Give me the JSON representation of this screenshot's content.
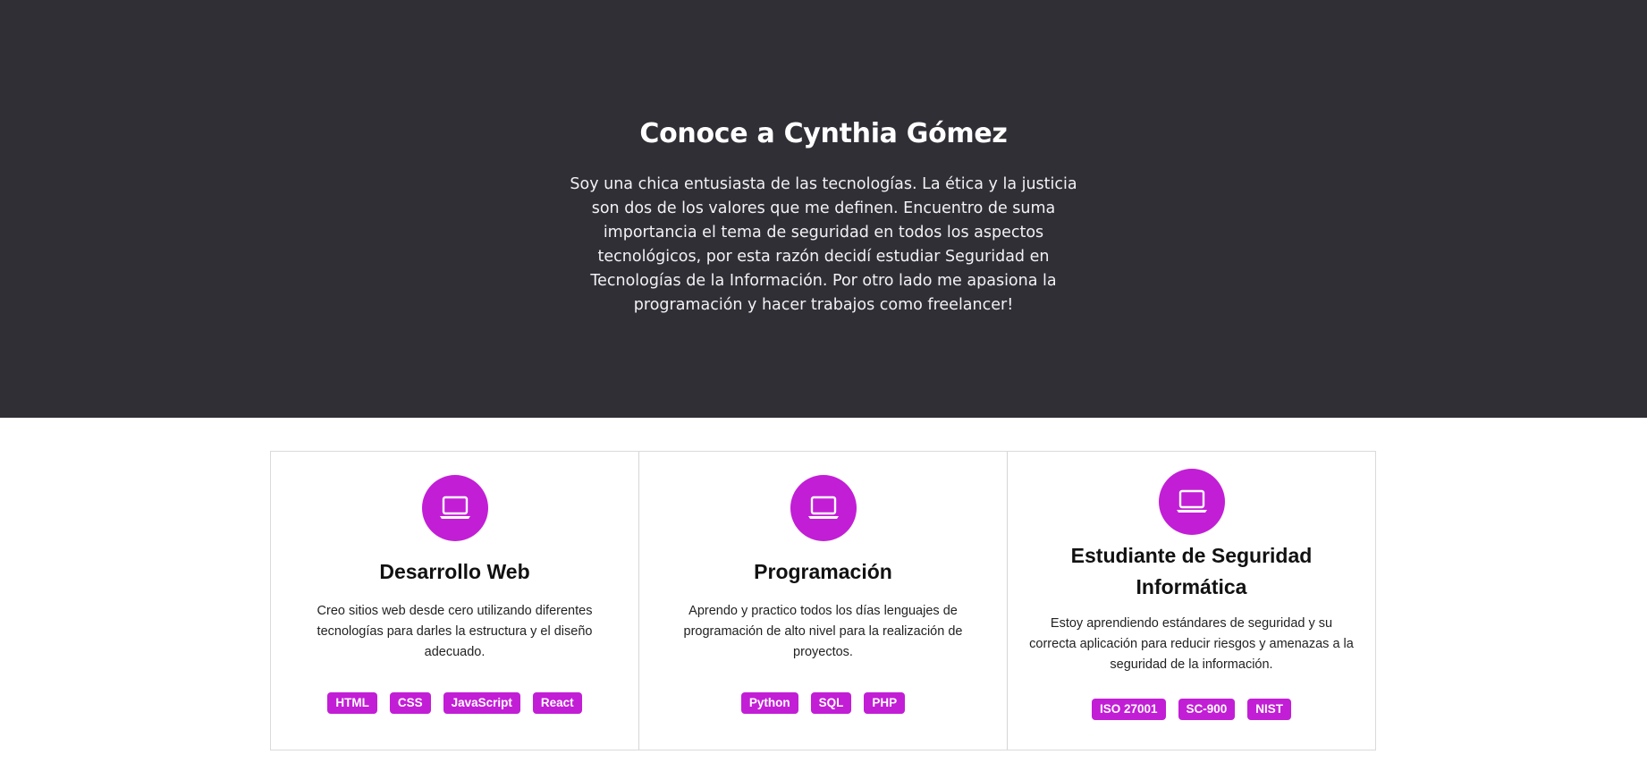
{
  "hero": {
    "title": "Conoce a Cynthia Gómez",
    "text": "Soy una chica entusiasta de las tecnologías. La ética y la justicia son dos de los valores que me definen. Encuentro de suma importancia el tema de seguridad en todos los aspectos tecnológicos, por esta razón decidí estudiar Seguridad en Tecnologías de la Información. Por otro lado me apasiona la programación y hacer trabajos como freelancer!"
  },
  "colors": {
    "hero_bg": "#302f36",
    "accent": "#c21ed6"
  },
  "cards": [
    {
      "icon": "laptop-icon",
      "title": "Desarrollo Web",
      "text": "Creo sitios web desde cero utilizando diferentes tecnologías para darles la estructura y el diseño adecuado.",
      "tags": [
        "HTML",
        "CSS",
        "JavaScript",
        "React"
      ]
    },
    {
      "icon": "laptop-icon",
      "title": "Programación",
      "text": "Aprendo y practico todos los días lenguajes de programación de alto nivel para la realización de proyectos.",
      "tags": [
        "Python",
        "SQL",
        "PHP"
      ]
    },
    {
      "icon": "laptop-icon",
      "title": "Estudiante de Seguridad Informática",
      "text": "Estoy aprendiendo estándares de seguridad y su correcta aplicación para reducir riesgos y amenazas a la seguridad de la información.",
      "tags": [
        "ISO 27001",
        "SC-900",
        "NIST"
      ]
    }
  ]
}
